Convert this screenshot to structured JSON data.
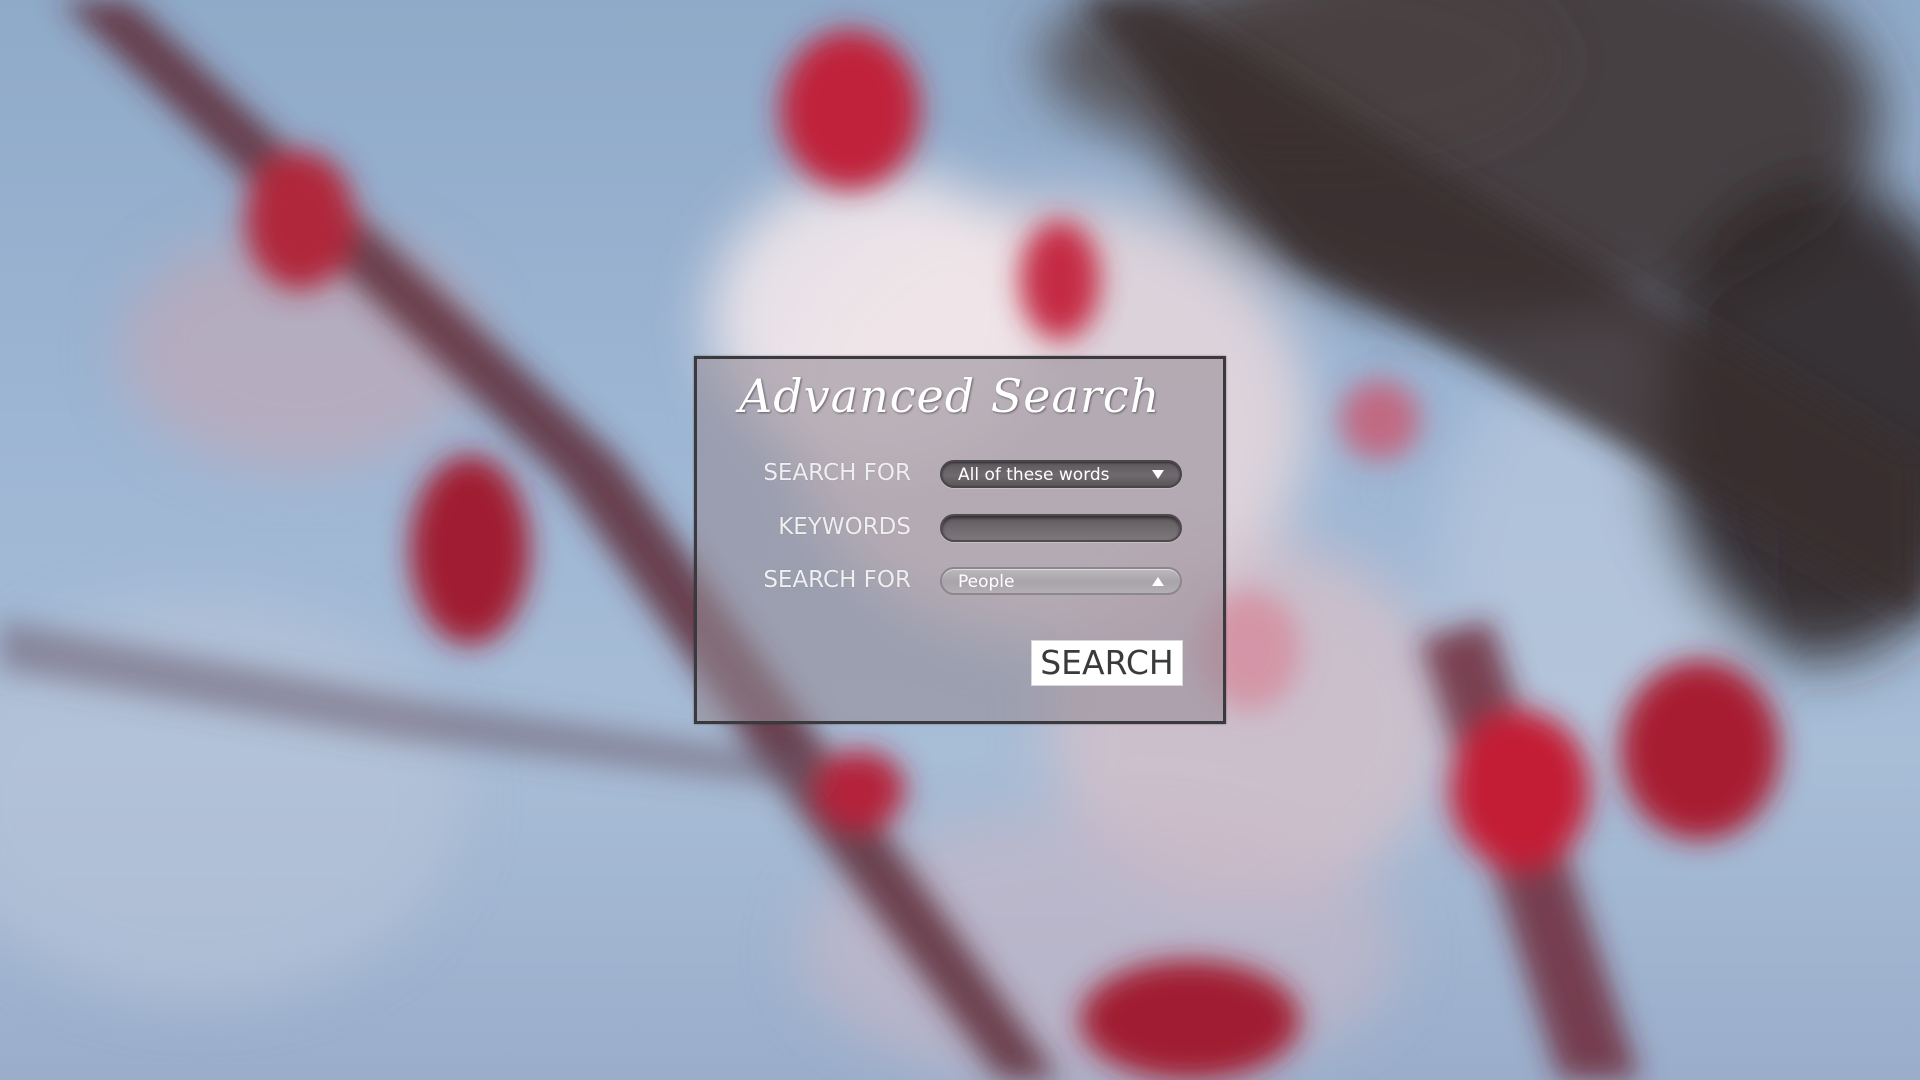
{
  "dialog": {
    "title": "Advanced Search",
    "rows": [
      {
        "label": "SEARCH FOR",
        "value": "All of these words",
        "state": "collapsed"
      },
      {
        "label": "KEYWORDS",
        "value": ""
      },
      {
        "label": "SEARCH FOR",
        "value": "People",
        "state": "expanded"
      }
    ],
    "search_button_label": "SEARCH"
  },
  "colors": {
    "panel_border": "#3a3a3e",
    "label_text": "#efefef",
    "button_bg": "#ffffff",
    "button_text": "#3a3a3a",
    "blossom_red": "#b8243a"
  },
  "icons": {
    "dropdown_collapsed": "chevron-down-icon",
    "dropdown_expanded": "chevron-up-icon"
  }
}
